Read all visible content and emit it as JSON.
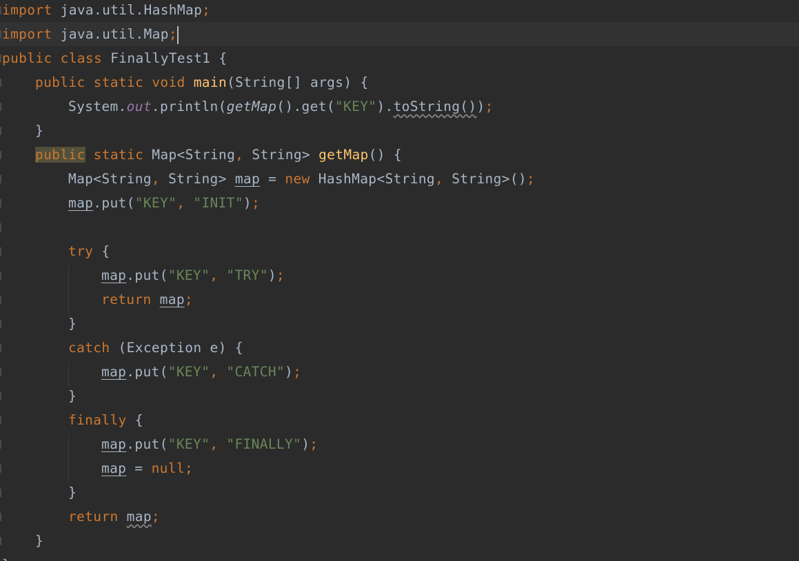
{
  "editor": {
    "lines": [
      {
        "tokens": [
          {
            "t": "import",
            "c": "kw"
          },
          {
            "t": " java.util.HashMap",
            "c": ""
          },
          {
            "t": ";",
            "c": "punct"
          }
        ]
      },
      {
        "tokens": [
          {
            "t": "import",
            "c": "kw"
          },
          {
            "t": " java.util.Map",
            "c": ""
          },
          {
            "t": ";",
            "c": "punct"
          }
        ],
        "current": true,
        "caret": true
      },
      {
        "tokens": [
          {
            "t": "public class",
            "c": "kw"
          },
          {
            "t": " FinallyTest1 {",
            "c": ""
          }
        ]
      },
      {
        "indent": 1,
        "tokens": [
          {
            "t": "public static void",
            "c": "kw"
          },
          {
            "t": " ",
            "c": ""
          },
          {
            "t": "main",
            "c": "fn"
          },
          {
            "t": "(String[] args) {",
            "c": ""
          }
        ]
      },
      {
        "indent": 2,
        "tokens": [
          {
            "t": "System.",
            "c": ""
          },
          {
            "t": "out",
            "c": "field"
          },
          {
            "t": ".println(",
            "c": ""
          },
          {
            "t": "getMap",
            "c": "static-call"
          },
          {
            "t": "().get(",
            "c": ""
          },
          {
            "t": "\"KEY\"",
            "c": "str"
          },
          {
            "t": ").",
            "c": ""
          },
          {
            "t": "toString()",
            "c": "wavy"
          },
          {
            "t": ")",
            "c": ""
          },
          {
            "t": ";",
            "c": "punct"
          }
        ]
      },
      {
        "indent": 1,
        "tokens": [
          {
            "t": "}",
            "c": ""
          }
        ]
      },
      {
        "indent": 1,
        "tokens": [
          {
            "t": "public",
            "c": "kw highlight-word"
          },
          {
            "t": " static",
            "c": "kw"
          },
          {
            "t": " Map<String",
            "c": ""
          },
          {
            "t": ",",
            "c": "punct"
          },
          {
            "t": " String> ",
            "c": ""
          },
          {
            "t": "getMap",
            "c": "fn"
          },
          {
            "t": "() {",
            "c": ""
          }
        ]
      },
      {
        "indent": 2,
        "tokens": [
          {
            "t": "Map<String",
            "c": ""
          },
          {
            "t": ",",
            "c": "punct"
          },
          {
            "t": " String> ",
            "c": ""
          },
          {
            "t": "map",
            "c": "ul"
          },
          {
            "t": " = ",
            "c": ""
          },
          {
            "t": "new",
            "c": "kw"
          },
          {
            "t": " HashMap<String",
            "c": ""
          },
          {
            "t": ",",
            "c": "punct"
          },
          {
            "t": " String>()",
            "c": ""
          },
          {
            "t": ";",
            "c": "punct"
          }
        ]
      },
      {
        "indent": 2,
        "tokens": [
          {
            "t": "map",
            "c": "ul"
          },
          {
            "t": ".put(",
            "c": ""
          },
          {
            "t": "\"KEY\"",
            "c": "str"
          },
          {
            "t": ",",
            "c": "punct"
          },
          {
            "t": " ",
            "c": ""
          },
          {
            "t": "\"INIT\"",
            "c": "str"
          },
          {
            "t": ")",
            "c": ""
          },
          {
            "t": ";",
            "c": "punct"
          }
        ]
      },
      {
        "indent": 0,
        "tokens": []
      },
      {
        "indent": 2,
        "tokens": [
          {
            "t": "try",
            "c": "kw"
          },
          {
            "t": " {",
            "c": ""
          }
        ]
      },
      {
        "indent": 3,
        "tokens": [
          {
            "t": "map",
            "c": "ul"
          },
          {
            "t": ".put(",
            "c": ""
          },
          {
            "t": "\"KEY\"",
            "c": "str"
          },
          {
            "t": ",",
            "c": "punct"
          },
          {
            "t": " ",
            "c": ""
          },
          {
            "t": "\"TRY\"",
            "c": "str"
          },
          {
            "t": ")",
            "c": ""
          },
          {
            "t": ";",
            "c": "punct"
          }
        ]
      },
      {
        "indent": 3,
        "tokens": [
          {
            "t": "return",
            "c": "kw"
          },
          {
            "t": " ",
            "c": ""
          },
          {
            "t": "map",
            "c": "ul"
          },
          {
            "t": ";",
            "c": "punct"
          }
        ]
      },
      {
        "indent": 2,
        "tokens": [
          {
            "t": "}",
            "c": ""
          }
        ]
      },
      {
        "indent": 2,
        "tokens": [
          {
            "t": "catch",
            "c": "kw"
          },
          {
            "t": " (Exception e) {",
            "c": ""
          }
        ]
      },
      {
        "indent": 3,
        "tokens": [
          {
            "t": "map",
            "c": "ul"
          },
          {
            "t": ".put(",
            "c": ""
          },
          {
            "t": "\"KEY\"",
            "c": "str"
          },
          {
            "t": ",",
            "c": "punct"
          },
          {
            "t": " ",
            "c": ""
          },
          {
            "t": "\"CATCH\"",
            "c": "str"
          },
          {
            "t": ")",
            "c": ""
          },
          {
            "t": ";",
            "c": "punct"
          }
        ]
      },
      {
        "indent": 2,
        "tokens": [
          {
            "t": "}",
            "c": ""
          }
        ]
      },
      {
        "indent": 2,
        "tokens": [
          {
            "t": "finally",
            "c": "kw"
          },
          {
            "t": " {",
            "c": ""
          }
        ]
      },
      {
        "indent": 3,
        "tokens": [
          {
            "t": "map",
            "c": "ul"
          },
          {
            "t": ".put(",
            "c": ""
          },
          {
            "t": "\"KEY\"",
            "c": "str"
          },
          {
            "t": ",",
            "c": "punct"
          },
          {
            "t": " ",
            "c": ""
          },
          {
            "t": "\"FINALLY\"",
            "c": "str"
          },
          {
            "t": ")",
            "c": ""
          },
          {
            "t": ";",
            "c": "punct"
          }
        ]
      },
      {
        "indent": 3,
        "tokens": [
          {
            "t": "map",
            "c": "ul"
          },
          {
            "t": " = ",
            "c": ""
          },
          {
            "t": "null",
            "c": "kw"
          },
          {
            "t": ";",
            "c": "punct"
          }
        ]
      },
      {
        "indent": 2,
        "tokens": [
          {
            "t": "}",
            "c": ""
          }
        ]
      },
      {
        "indent": 2,
        "tokens": [
          {
            "t": "return",
            "c": "kw"
          },
          {
            "t": " ",
            "c": ""
          },
          {
            "t": "map",
            "c": "wavy"
          },
          {
            "t": ";",
            "c": "punct"
          }
        ]
      },
      {
        "indent": 1,
        "tokens": [
          {
            "t": "}",
            "c": ""
          }
        ]
      },
      {
        "indent": 0,
        "tokens": [
          {
            "t": "}",
            "c": ""
          }
        ]
      }
    ]
  },
  "colors": {
    "background": "#2b2b2b",
    "current_line": "#323232",
    "keyword": "#cc7832",
    "method_decl": "#ffc66d",
    "string": "#6a8759",
    "static_field": "#9876aa",
    "default_text": "#a9b7c6"
  }
}
